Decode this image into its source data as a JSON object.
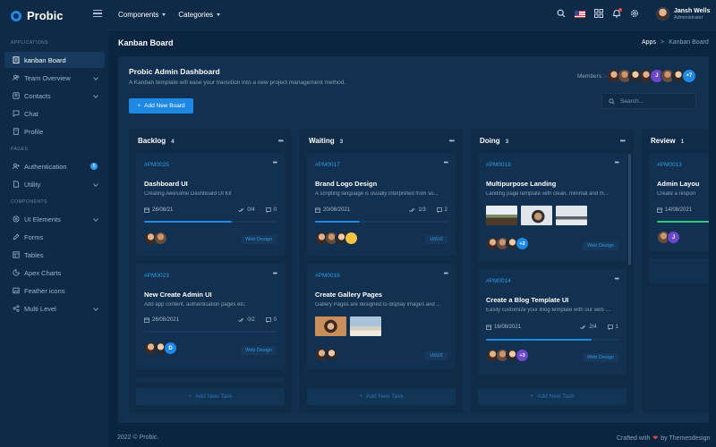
{
  "app": {
    "name": "Probic"
  },
  "topnav": {
    "components": "Components",
    "categories": "Categories"
  },
  "user": {
    "name": "Jansh Wells",
    "role": "Administrator"
  },
  "sidebar": {
    "sections": {
      "applications": "APPLICATIONS",
      "pages": "PAGES",
      "components": "COMPONENTS"
    },
    "items": [
      {
        "label": "kanban Board"
      },
      {
        "label": "Team Overview"
      },
      {
        "label": "Contacts"
      },
      {
        "label": "Chat"
      },
      {
        "label": "Profile"
      },
      {
        "label": "Authentication",
        "badge": "5"
      },
      {
        "label": "Utility"
      },
      {
        "label": "UI Elements"
      },
      {
        "label": "Forms"
      },
      {
        "label": "Tables"
      },
      {
        "label": "Apex Charts"
      },
      {
        "label": "Feather icons"
      },
      {
        "label": "Multi Level"
      }
    ]
  },
  "page": {
    "title": "Kanban Board",
    "breadcrumb": {
      "root": "Apps",
      "sep": ">",
      "current": "Kanban Board"
    }
  },
  "board": {
    "title": "Probic Admin Dashboard",
    "subtitle": "A Kanban template will ease your transition into a new project management method.",
    "add_button": "Add New Board",
    "members_label": "Members :-",
    "members_j": "J",
    "members_more": "+7",
    "search_placeholder": "Search..."
  },
  "columns": [
    {
      "name": "Backlog",
      "count": "4",
      "add_task": "Add New Task"
    },
    {
      "name": "Waiting",
      "count": "3",
      "add_task": "Add New Task"
    },
    {
      "name": "Doing",
      "count": "3",
      "add_task": "Add New Task"
    },
    {
      "name": "Review",
      "count": "1"
    }
  ],
  "tasks": {
    "backlog": [
      {
        "id": "#PM0025",
        "title": "Dashboard UI",
        "desc": "Creating Awesome Dashboard UI Kit",
        "date": "28/08/21",
        "checks": "0/4",
        "comments": "0",
        "progress": 0.66,
        "tag": "Web Design"
      },
      {
        "id": "#PM0023",
        "title": "New Create Admin UI",
        "desc": "Add app content, authentication pages etc.",
        "date": "26/08/2021",
        "checks": "0/2",
        "comments": "0",
        "avatar_d": "D",
        "tag": "Web Design"
      }
    ],
    "waiting": [
      {
        "id": "#PM0017",
        "title": "Brand Logo Design",
        "desc": "A scripting language is usually interpreted from so...",
        "date": "20/08/2021",
        "checks": "1/3",
        "comments": "2",
        "progress": 0.34,
        "tag": "UI/UX"
      },
      {
        "id": "#PM0016",
        "title": "Create Gallery Pages",
        "desc": "Gallery Pages are designed to display images and ...",
        "tag": "UI/UX"
      }
    ],
    "doing": [
      {
        "id": "#PM0018",
        "title": "Multipurpose Landing",
        "desc": "Landing page template with clean, minimal and m...",
        "avatars_more": "+2",
        "tag": "Web Design"
      },
      {
        "id": "#PM0014",
        "title": "Create a Blog Template UI",
        "desc": "Easily customize your Blog template with our web ...",
        "date": "16/08/2021",
        "checks": "2/4",
        "comments": "1",
        "progress": 0.8,
        "avatars_more": "+3",
        "tag": "Web Design"
      }
    ],
    "review": [
      {
        "id": "#PM0013",
        "title": "Admin Layou",
        "desc": "Create a respon",
        "date": "14/08/2021",
        "progress": 1.0,
        "avatar_j": "J"
      }
    ]
  },
  "footer": {
    "copyright": "2022 © Probic.",
    "crafted": "Crafted with",
    "by": "by Themesdesign"
  },
  "colors": {
    "accent": "#1e88e5",
    "background": "#0b2540",
    "card": "#12304f",
    "success": "#2fc27a"
  }
}
